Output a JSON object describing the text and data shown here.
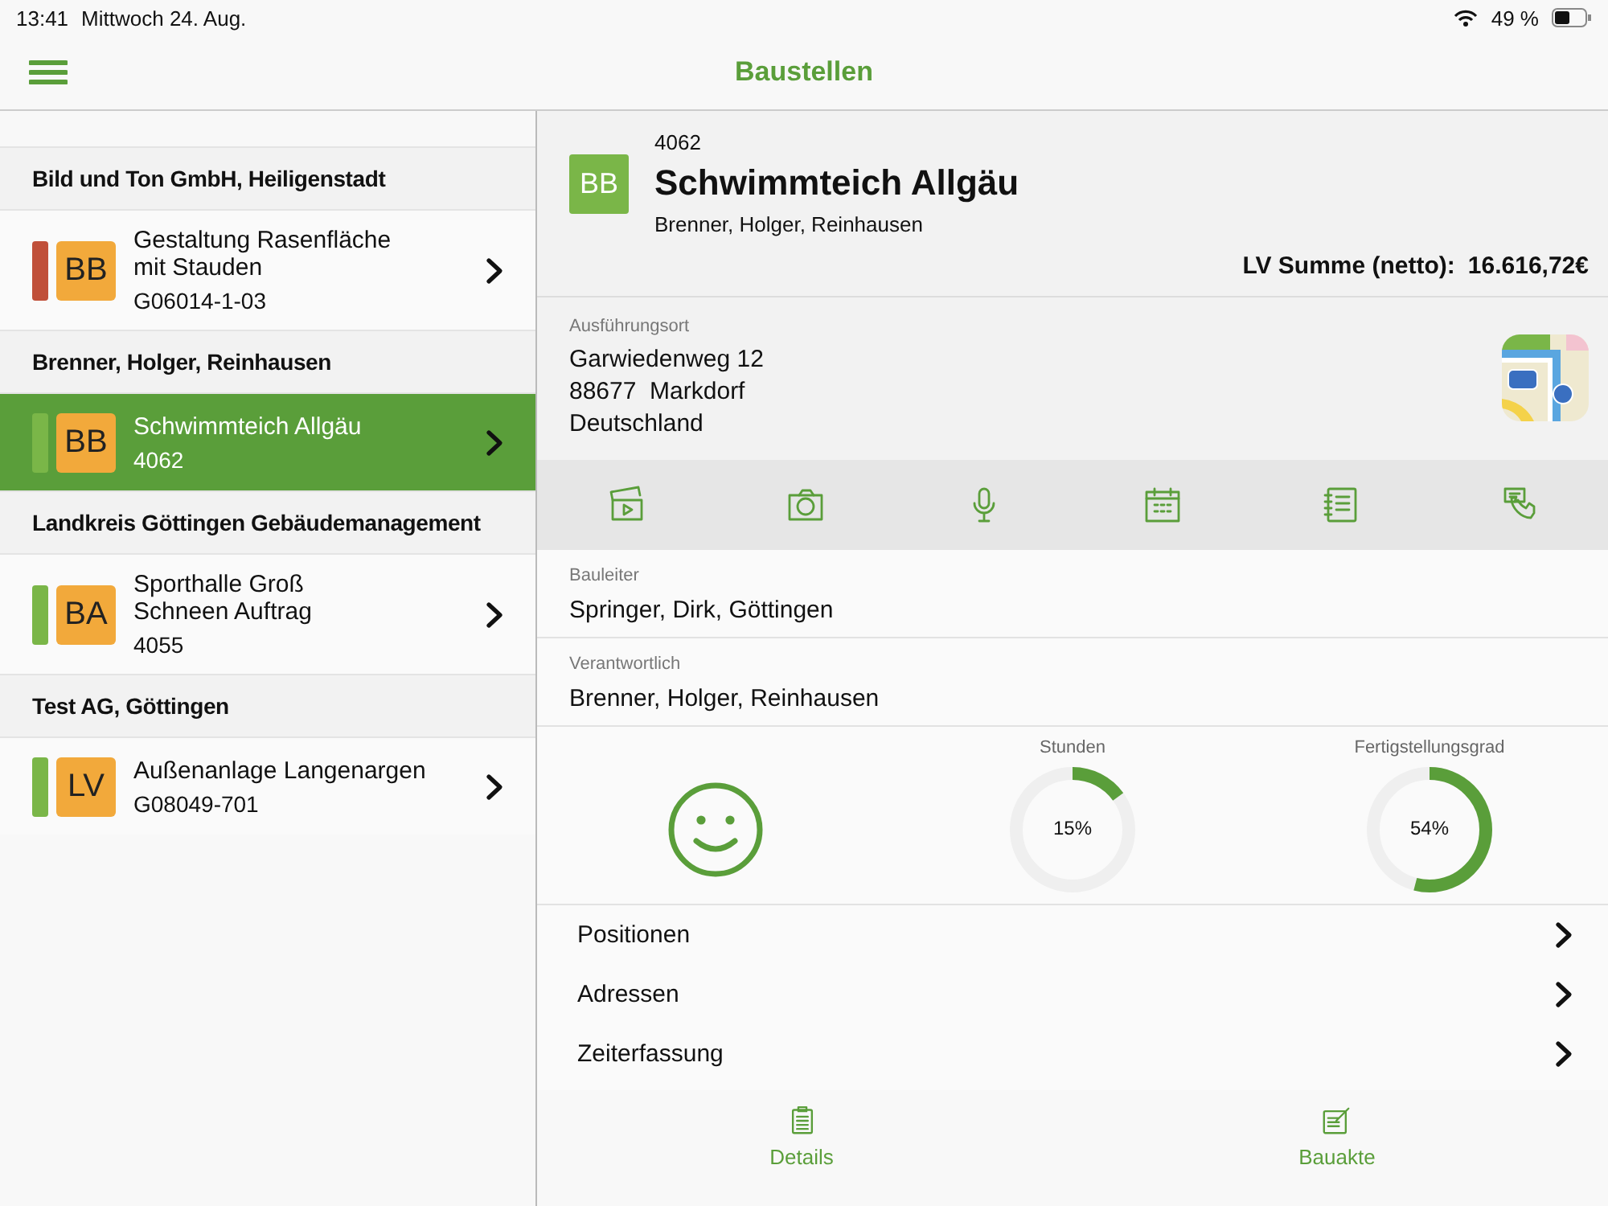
{
  "status_bar": {
    "time": "13:41",
    "date": "Mittwoch 24. Aug.",
    "battery": "49 %"
  },
  "nav": {
    "title": "Baustellen"
  },
  "groups": [
    {
      "title": "Bild und Ton GmbH, Heiligenstadt",
      "items": [
        {
          "badge": "BB",
          "lines": [
            "Gestaltung Rasenfläche",
            "mit Stauden"
          ],
          "number": "G06014-1-03",
          "color": "#c0503a",
          "selected": false
        }
      ]
    },
    {
      "title": "Brenner, Holger, Reinhausen",
      "items": [
        {
          "badge": "BB",
          "lines": [
            "Schwimmteich Allgäu"
          ],
          "number": "4062",
          "color": "#7ab648",
          "selected": true
        }
      ]
    },
    {
      "title": "Landkreis Göttingen Gebäudemanagement",
      "items": [
        {
          "badge": "BA",
          "lines": [
            "Sporthalle Groß",
            "Schneen Auftrag"
          ],
          "number": "4055",
          "color": "#7ab648",
          "selected": false
        }
      ]
    },
    {
      "title": "Test AG, Göttingen",
      "items": [
        {
          "badge": "LV",
          "lines": [
            "Außenanlage Langenargen"
          ],
          "number": "G08049-701",
          "color": "#7ab648",
          "selected": false
        }
      ]
    }
  ],
  "detail": {
    "number": "4062",
    "badge": "BB",
    "title": "Schwimmteich Allgäu",
    "client": "Brenner, Holger, Reinhausen",
    "sum_label": "LV Summe (netto):",
    "sum_value": "16.616,72€",
    "location_label": "Ausführungsort",
    "address": [
      "Garwiedenweg 12",
      "88677  Markdorf",
      "Deutschland"
    ],
    "fields": [
      {
        "label": "Bauleiter",
        "value": "Springer, Dirk, Göttingen"
      },
      {
        "label": "Verantwortlich",
        "value": "Brenner, Holger, Reinhausen"
      }
    ],
    "gauges": [
      {
        "label": "Stunden",
        "level": 0.15,
        "reading": "15%"
      },
      {
        "label": "Fertigstellungsgrad",
        "level": 0.54,
        "reading": "54%"
      }
    ],
    "links": [
      "Positionen",
      "Adressen",
      "Zeiterfassung"
    ]
  },
  "tabs": [
    {
      "label": "Details",
      "kind": "clipboard"
    },
    {
      "label": "Bauakte",
      "kind": "edit"
    }
  ]
}
